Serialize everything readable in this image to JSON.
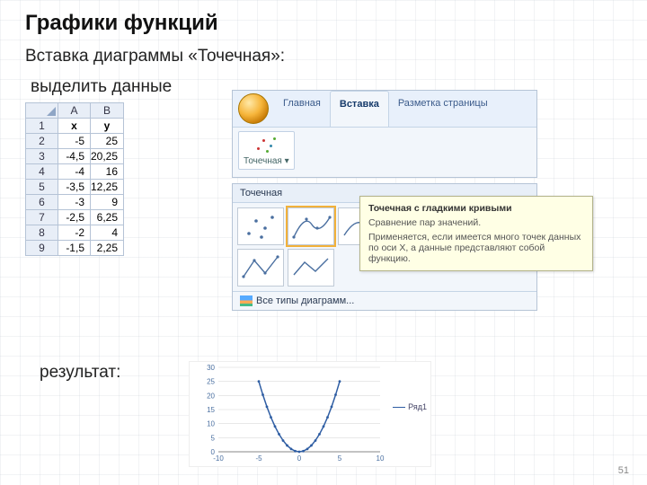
{
  "title": "Графики функций",
  "subtitle": "Вставка диаграммы «Точечная»:",
  "label_select": "выделить данные",
  "label_result": "результат:",
  "page_number": "51",
  "spreadsheet": {
    "cols": [
      "A",
      "B"
    ],
    "header_row": [
      "x",
      "y"
    ],
    "rows": [
      [
        "-5",
        "25"
      ],
      [
        "-4,5",
        "20,25"
      ],
      [
        "-4",
        "16"
      ],
      [
        "-3,5",
        "12,25"
      ],
      [
        "-3",
        "9"
      ],
      [
        "-2,5",
        "6,25"
      ],
      [
        "-2",
        "4"
      ],
      [
        "-1,5",
        "2,25"
      ]
    ]
  },
  "ribbon": {
    "tabs": [
      "Главная",
      "Вставка",
      "Разметка страницы"
    ],
    "active_tab": "Вставка",
    "scatter_label": "Точечная",
    "gallery_title": "Точечная",
    "all_charts": "Все типы диаграмм..."
  },
  "tooltip": {
    "title": "Точечная с гладкими кривыми",
    "line1": "Сравнение пар значений.",
    "line2": "Применяется, если имеется много точек данных по оси X, а данные представляют собой функцию."
  },
  "chart_data": {
    "type": "line",
    "title": "",
    "xlabel": "",
    "ylabel": "",
    "xlim": [
      -10,
      10
    ],
    "ylim": [
      0,
      30
    ],
    "x_ticks": [
      -10,
      -5,
      0,
      5,
      10
    ],
    "y_ticks": [
      0,
      5,
      10,
      15,
      20,
      25,
      30
    ],
    "series": [
      {
        "name": "Ряд1",
        "x": [
          -5,
          -4.5,
          -4,
          -3.5,
          -3,
          -2.5,
          -2,
          -1.5,
          -1,
          -0.5,
          0,
          0.5,
          1,
          1.5,
          2,
          2.5,
          3,
          3.5,
          4,
          4.5,
          5
        ],
        "values": [
          25,
          20.25,
          16,
          12.25,
          9,
          6.25,
          4,
          2.25,
          1,
          0.25,
          0,
          0.25,
          1,
          2.25,
          4,
          6.25,
          9,
          12.25,
          16,
          20.25,
          25
        ]
      }
    ]
  }
}
